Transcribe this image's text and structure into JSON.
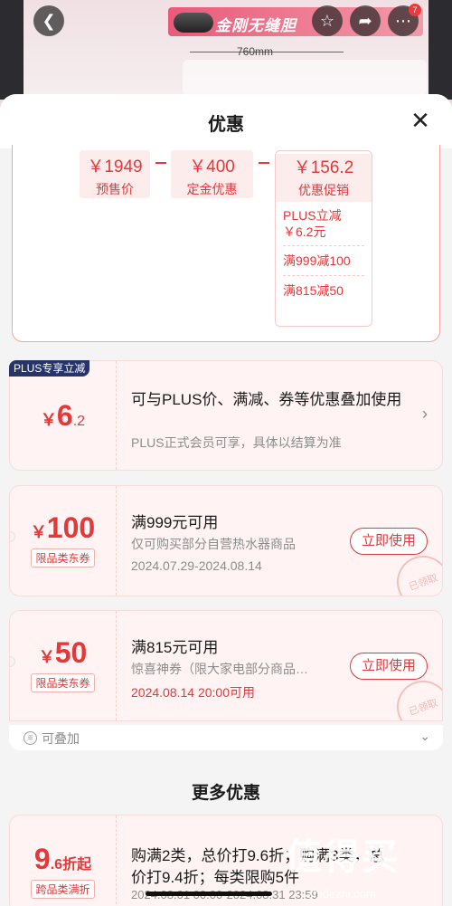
{
  "backdrop": {
    "banner_text": "金刚无缝胆",
    "dimension_label": "760mm",
    "badge_count": "7"
  },
  "sheet": {
    "title": "优惠",
    "close_icon": "close-icon"
  },
  "calc": {
    "presale": {
      "amount": "￥1949",
      "label": "预售价"
    },
    "deposit": {
      "amount": "￥400",
      "label": "定金优惠"
    },
    "promo": {
      "amount": "￥156.2",
      "label": "优惠促销"
    },
    "promo_items": [
      "PLUS立减",
      "￥6.2元",
      "满999减100",
      "满815减50"
    ]
  },
  "plus_card": {
    "flag": "PLUS专享立减",
    "currency": "￥",
    "amount_int": "6",
    "amount_dec": ".2",
    "title": "可与PLUS价、满减、券等优惠叠加使用",
    "desc": "PLUS正式会员可享，具体以结算为准"
  },
  "coupon1": {
    "currency": "￥",
    "amount": "100",
    "tag": "限品类东券",
    "title": "满999元可用",
    "desc": "仅可购买部分自营热水器商品",
    "date": "2024.07.29-2024.08.14",
    "button": "立即使用",
    "stamp": "已领取"
  },
  "coupon2": {
    "currency": "￥",
    "amount": "50",
    "tag": "限品类东券",
    "title": "满815元可用",
    "desc": "惊喜神券（限大家电部分商品…",
    "date": "2024.08.14 20:00可用",
    "button": "立即使用",
    "stamp": "已领取"
  },
  "stackable": {
    "label": "可叠加"
  },
  "more": {
    "title": "更多优惠"
  },
  "discount_card": {
    "amount_int": "9",
    "amount_rest": ".6折起",
    "tag": "跨品类满折",
    "line1": "购满2类，总价打9.6折；购满3类，总",
    "line2": "价打9.4折；每类限购5件",
    "date": "2024.08.01 00:00-2024.08.31 23:59"
  },
  "watermark": {
    "text": "值得买",
    "sub": "zhidezhi.com"
  }
}
